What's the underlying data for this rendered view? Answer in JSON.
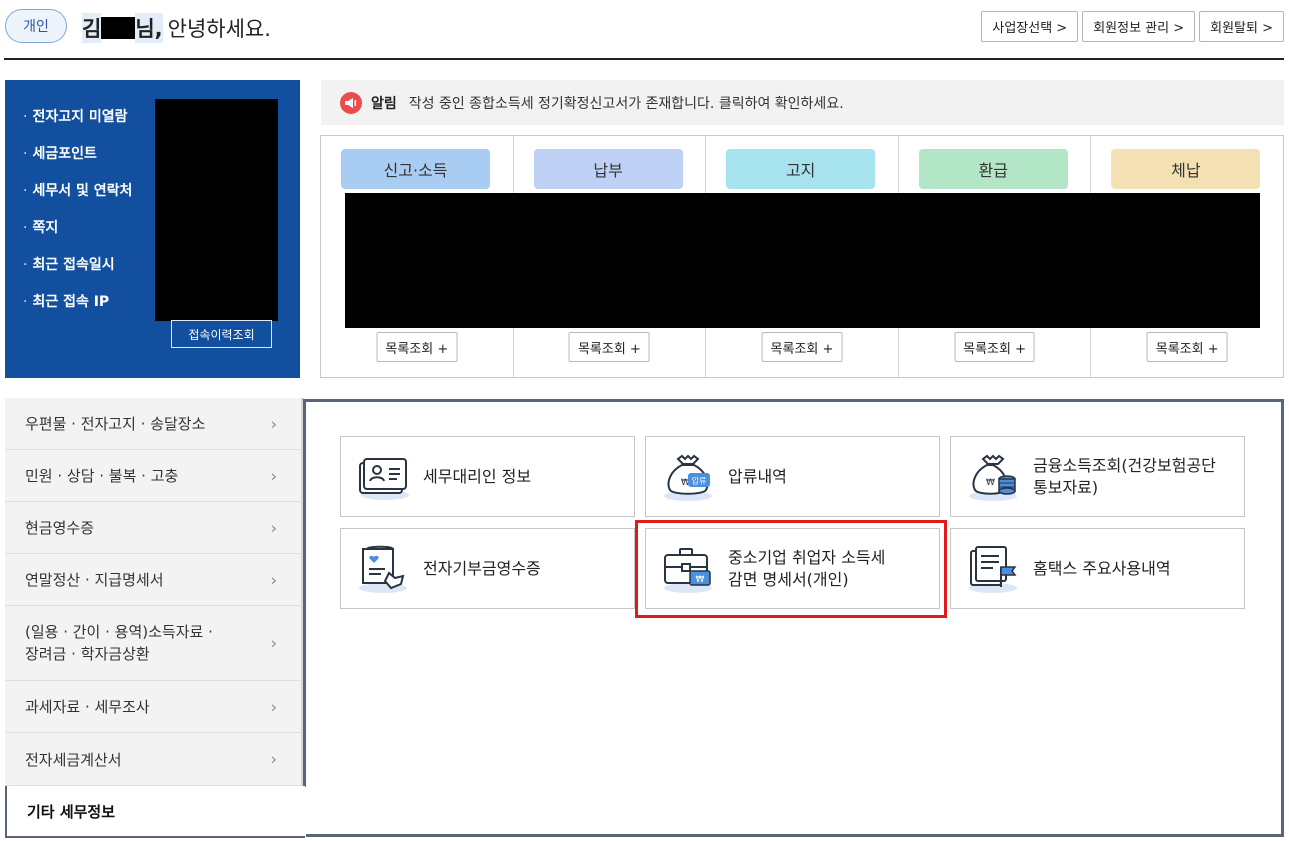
{
  "header": {
    "user_type": "개인",
    "greeting_name_first": "김",
    "greeting_name_last": "님,",
    "greeting_text": "안녕하세요.",
    "buttons": [
      "사업장선택 >",
      "회원정보 관리 >",
      "회원탈퇴 >"
    ]
  },
  "info_panel": {
    "items": [
      "전자고지 미열람",
      "세금포인트",
      "세무서 및 연락처",
      "쪽지",
      "최근 접속일시",
      "최근 접속 IP"
    ],
    "history_button": "접속이력조회"
  },
  "notice": {
    "label": "알림",
    "text": "작성 중인 종합소득세 정기확정신고서가 존재합니다. 클릭하여 확인하세요."
  },
  "status_tabs": [
    {
      "label": "신고·소득",
      "color": "#a9ccf2",
      "button": "목록조회 +"
    },
    {
      "label": "납부",
      "color": "#bfd0f5",
      "button": "목록조회 +"
    },
    {
      "label": "고지",
      "color": "#a6e3ef",
      "button": "목록조회 +"
    },
    {
      "label": "환급",
      "color": "#b2e6c6",
      "button": "목록조회 +"
    },
    {
      "label": "체납",
      "color": "#f3e1b3",
      "button": "목록조회 +"
    }
  ],
  "side_menu": {
    "items": [
      "우편물 · 전자고지 · 송달장소",
      "민원 · 상담 · 불복 · 고충",
      "현금영수증",
      "연말정산 · 지급명세서",
      "(일용 · 간이 · 용역)소득자료 ·",
      "장려금 · 학자금상환",
      "과세자료 · 세무조사",
      "전자세금계산서"
    ],
    "active": "기타 세무정보"
  },
  "services": [
    {
      "label": "세무대리인 정보",
      "icon": "tax-agent-icon"
    },
    {
      "label": "압류내역",
      "icon": "seizure-money-bag-icon",
      "icon_text": "압류"
    },
    {
      "label_1": "금융소득조회(건강보험공단",
      "label_2": "통보자료)",
      "icon": "financial-income-icon"
    },
    {
      "label": "전자기부금영수증",
      "icon": "donation-receipt-icon"
    },
    {
      "label_1": "중소기업 취업자 소득세",
      "label_2": "감면 명세서(개인)",
      "icon": "sme-tax-reduction-icon"
    },
    {
      "label": "홈택스 주요사용내역",
      "icon": "hometax-usage-icon"
    }
  ],
  "accent_colors": {
    "brand_blue": "#12509f",
    "highlight_red": "#e01b1b",
    "notice_red": "#e94d4d",
    "panel_border": "#5a6577"
  }
}
